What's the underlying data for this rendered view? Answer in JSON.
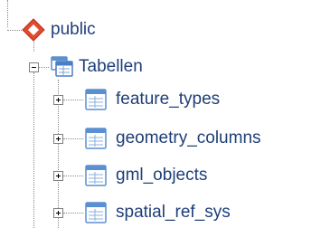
{
  "tree": {
    "schema": {
      "label": "public",
      "icon": "schema-diamond-icon",
      "expanded": true
    },
    "tables_node": {
      "label": "Tabellen",
      "icon": "tables-folder-icon",
      "expanded": true
    },
    "tables": [
      {
        "label": "feature_types",
        "icon": "table-icon",
        "expanded": false
      },
      {
        "label": "geometry_columns",
        "icon": "table-icon",
        "expanded": false
      },
      {
        "label": "gml_objects",
        "icon": "table-icon",
        "expanded": false
      },
      {
        "label": "spatial_ref_sys",
        "icon": "table-icon",
        "expanded": false
      }
    ]
  },
  "colors": {
    "label": "#1f3f78",
    "schema_icon": "#d9412a",
    "table_icon": "#5b8fd1",
    "connector": "#8a8a8a"
  }
}
